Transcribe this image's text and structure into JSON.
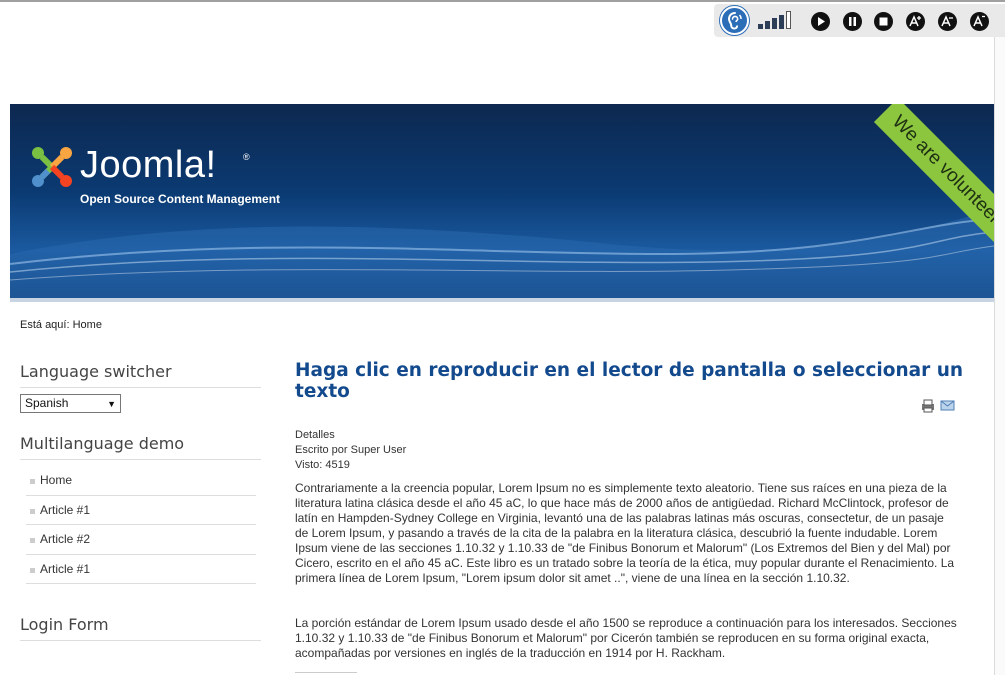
{
  "toolbar": {
    "buttons": [
      "ear-icon",
      "volume-icon",
      "play-icon",
      "pause-icon",
      "stop-icon",
      "font-increase-icon",
      "font-decrease-icon",
      "font-reset-icon"
    ]
  },
  "header": {
    "logo_text": "Joomla!",
    "logo_reg": "®",
    "tagline": "Open Source Content Management",
    "ribbon": "We are volunteers !"
  },
  "breadcrumb": {
    "prefix": "Está aquí:",
    "home": "Home"
  },
  "sidebar": {
    "language_title": "Language switcher",
    "language_selected": "Spanish",
    "multilang_title": "Multilanguage demo",
    "menu_items": [
      "Home",
      "Article #1",
      "Article #2",
      "Article #1"
    ],
    "login_title": "Login Form"
  },
  "article": {
    "title": "Haga clic en reproducir en el lector de pantalla o seleccionar un texto",
    "details_label": "Detalles",
    "author": "Escrito por Super User",
    "hits": "Visto: 4519",
    "paragraph1": "Contrariamente a la creencia popular, Lorem Ipsum no es simplemente texto aleatorio. Tiene sus raíces en una pieza de la literatura latina clásica desde el año 45 aC, lo que hace más de 2000 años de antigüedad. Richard McClintock, profesor de latín en Hampden-Sydney College en Virginia, levantó una de las palabras latinas más oscuras, consectetur, de un pasaje de Lorem Ipsum, y pasando a través de la cita de la palabra en la literatura clásica, descubrió la fuente indudable. Lorem Ipsum viene de las secciones 1.10.32 y 1.10.33 de \"de Finibus Bonorum et Malorum\" (Los Extremos del Bien y del Mal) por Cicero, escrito en el año 45 aC. Este libro es un tratado sobre la teoría de la ética, muy popular durante el Renacimiento. La primera línea de Lorem Ipsum, \"Lorem ipsum dolor sit amet ..\", viene de una línea en la sección 1.10.32.",
    "paragraph2": "La porción estándar de Lorem Ipsum usado desde el año 1500 se reproduce a continuación para los interesados. Secciones 1.10.32 y 1.10.33 de \"de Finibus Bonorum et Malorum\" por Cicerón también se reproducen en su forma original exacta, acompañadas por versiones en inglés de la traducción en 1914 por H. Rackham."
  },
  "colors": {
    "heading": "#134a8e",
    "banner": "#0b3a72",
    "ribbon": "#8cc63f",
    "toolbar_accent": "#2c6db7"
  }
}
